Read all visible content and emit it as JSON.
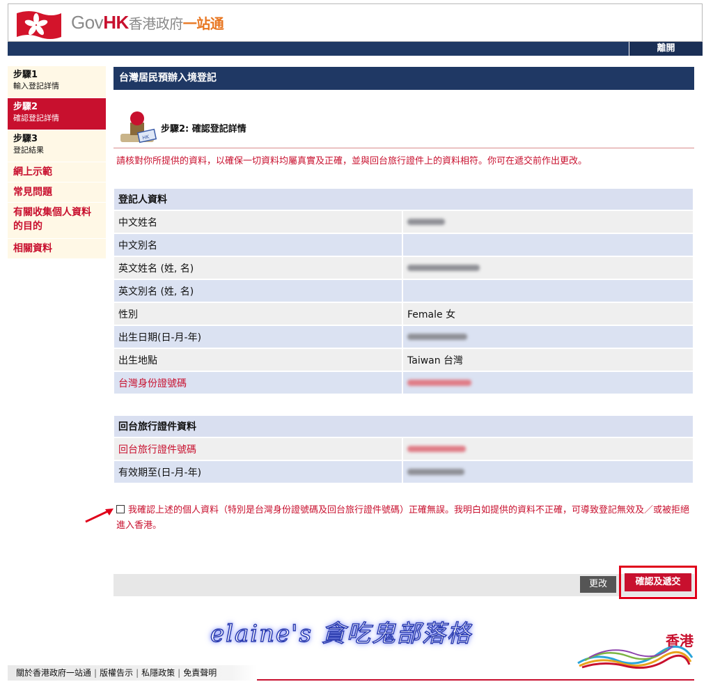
{
  "header": {
    "logo_gov": "Gov",
    "logo_hk": "HK",
    "logo_cn": "香港政府",
    "logo_one": "一站通",
    "logout": "離開"
  },
  "sidebar": {
    "steps": [
      {
        "title": "步驟1",
        "sub": "輸入登記詳情"
      },
      {
        "title": "步驟2",
        "sub": "確認登記詳情"
      },
      {
        "title": "步驟3",
        "sub": "登記結果"
      }
    ],
    "links": [
      "網上示範",
      "常見問題",
      "有關收集個人資料的目的",
      "相關資料"
    ]
  },
  "main": {
    "title": "台灣居民預辦入境登記",
    "step_heading": "步驟2: 確認登記詳情",
    "note": "請核對你所提供的資料，以確保一切資料均屬真實及正確，並與回台旅行證件上的資料相符。你可在遞交前作出更改。"
  },
  "registrant": {
    "heading": "登記人資料",
    "rows": [
      {
        "label": "中文姓名",
        "value": ""
      },
      {
        "label": "中文別名",
        "value": ""
      },
      {
        "label": "英文姓名 (姓, 名)",
        "value": ""
      },
      {
        "label": "英文別名 (姓, 名)",
        "value": ""
      },
      {
        "label": "性別",
        "value": "Female 女"
      },
      {
        "label": "出生日期(日-月-年)",
        "value": ""
      },
      {
        "label": "出生地點",
        "value": "Taiwan 台灣"
      },
      {
        "label": "台灣身份證號碼",
        "value": ""
      }
    ]
  },
  "travel_doc": {
    "heading": "回台旅行證件資料",
    "rows": [
      {
        "label": "回台旅行證件號碼",
        "value": ""
      },
      {
        "label": "有效期至(日-月-年)",
        "value": ""
      }
    ]
  },
  "declaration": "我確認上述的個人資料（特別是台灣身份證號碼及回台旅行證件號碼）正確無誤。我明白如提供的資料不正確，可導致登記無效及／或被拒絕進入香港。",
  "buttons": {
    "edit": "更改",
    "confirm": "確認及遞交"
  },
  "watermark": "elaine's 貪吃鬼部落格",
  "brand_text": "香港",
  "footer": {
    "links": [
      "關於香港政府一站通",
      "版權告示",
      "私隱政策",
      "免責聲明"
    ]
  },
  "colors": {
    "navy": "#1f3864",
    "red": "#c8102e",
    "row_gray": "#efefef",
    "row_blue": "#dbe2f2"
  }
}
